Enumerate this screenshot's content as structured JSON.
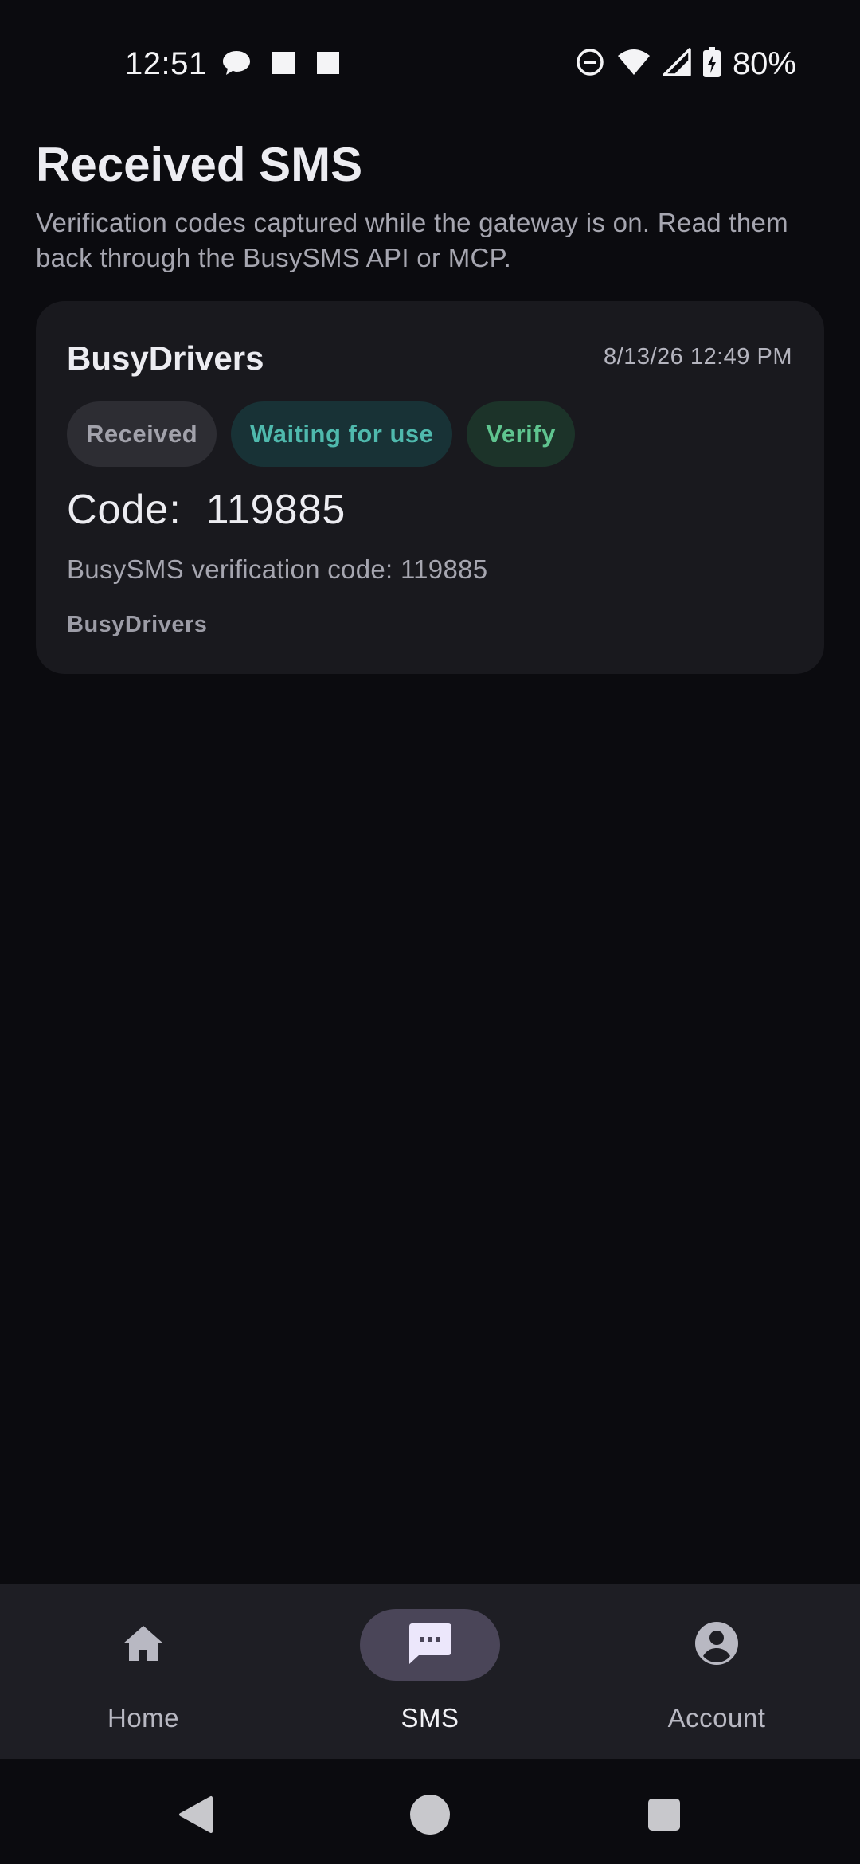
{
  "status_bar": {
    "time": "12:51",
    "battery": "80%",
    "icons": [
      "chat-bubble-icon",
      "square-icon",
      "square-icon",
      "dnd-icon",
      "wifi-icon",
      "signal-icon",
      "battery-charging-icon"
    ]
  },
  "header": {
    "title": "Received SMS",
    "subtitle": "Verification codes captured while the gateway is on. Read them back through the BusySMS API or MCP."
  },
  "messages": [
    {
      "sender": "BusyDrivers",
      "time": "8/13/26 12:49 PM",
      "badges": [
        "Received",
        "Waiting for use",
        "Verify"
      ],
      "code_display": "Code:  119885",
      "body": "BusySMS verification code: 119885",
      "footer": "BusyDrivers"
    }
  ],
  "bottom_nav": {
    "items": [
      {
        "label": "Home",
        "icon": "home-icon",
        "active": false
      },
      {
        "label": "SMS",
        "icon": "sms-icon",
        "active": true
      },
      {
        "label": "Account",
        "icon": "account-icon",
        "active": false
      }
    ]
  },
  "system_nav": {
    "icons": [
      "back-icon",
      "home-circle-icon",
      "recents-icon"
    ]
  },
  "colors": {
    "background": "#0b0b0f",
    "card": "#19191e",
    "waiting_badge": "#4fb9ad",
    "verify_badge": "#5fc48f",
    "nav_active_pill": "#4a4558"
  }
}
